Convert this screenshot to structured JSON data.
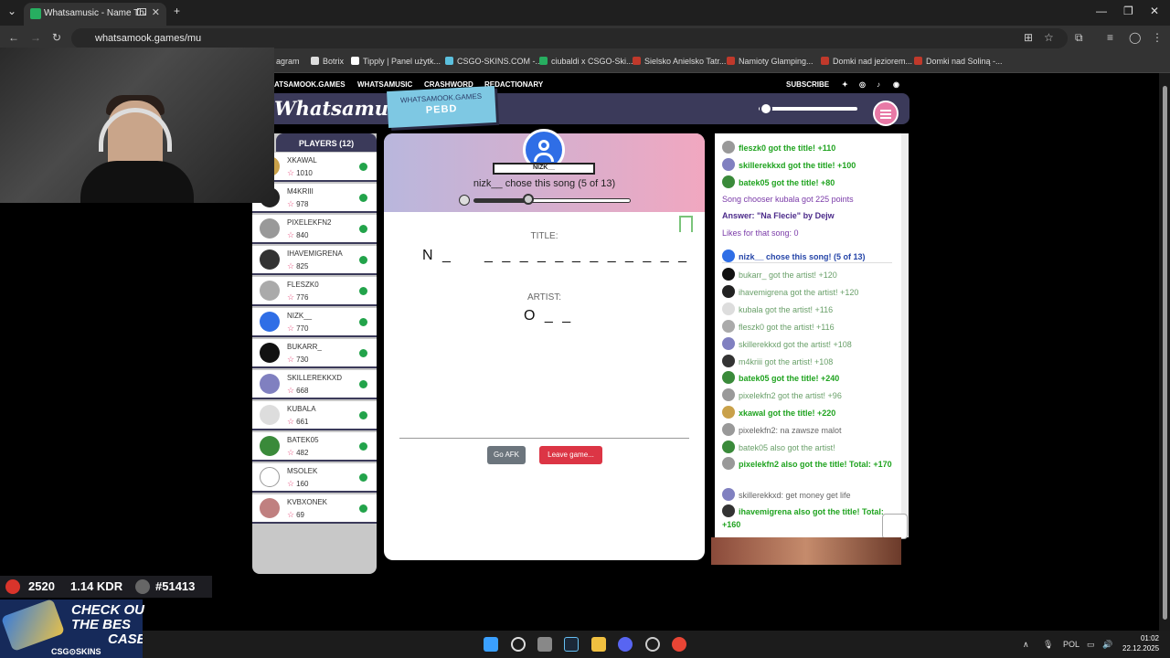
{
  "browser": {
    "tab_title": "Whatsamusic - Name That",
    "url": "whatsamook.games/mu",
    "bookmarks": [
      "agram",
      "Botrix",
      "Tipply | Panel użytk...",
      "CSGO-SKINS.COM -...",
      "ciubaldi x CSGO-Ski...",
      "Sielsko Anielsko Tatr...",
      "Namioty Glamping...",
      "Domki nad jeziorem...",
      "Domki nad Soliną -..."
    ]
  },
  "site_nav": {
    "items": [
      "ATSAMOOK.GAMES",
      "WHATSAMUSIC",
      "CRASHWORD",
      "REDACTIONARY"
    ],
    "subscribe": "SUBSCRIBE"
  },
  "header": {
    "logo": "Whatsamusic",
    "badge_line1": "WHATSAMOOK.GAMES",
    "badge_line2": "PEBD"
  },
  "players": {
    "heading": "PLAYERS (12)",
    "list": [
      {
        "name": "XKAWAL",
        "score": "1010"
      },
      {
        "name": "M4KRIII",
        "score": "978"
      },
      {
        "name": "PIXELEKFN2",
        "score": "840"
      },
      {
        "name": "IHAVEMIGRENA",
        "score": "825"
      },
      {
        "name": "FLESZK0",
        "score": "776"
      },
      {
        "name": "NIZK__",
        "score": "770"
      },
      {
        "name": "BUKARR_",
        "score": "730"
      },
      {
        "name": "SKILLEREKKXD",
        "score": "668"
      },
      {
        "name": "KUBALA",
        "score": "661"
      },
      {
        "name": "BATEK05",
        "score": "482"
      },
      {
        "name": "MSOLEK",
        "score": "160"
      },
      {
        "name": "KVBXONEK",
        "score": "69"
      }
    ]
  },
  "round": {
    "chooser_ribbon": "NIZK__",
    "chooser_text": "nizk__ chose this song (5 of 13)",
    "progress": 0.35,
    "title_label": "TITLE:",
    "title_hint_1": "N _",
    "title_hint_2": "_ _ _ _ _",
    "title_hint_3": "_ _ _ _ _ _ _",
    "artist_label": "ARTIST:",
    "artist_hint": "O _ _",
    "afk_button": "Go AFK",
    "leave_button": "Leave game..."
  },
  "chat": {
    "lines": [
      {
        "text": "fleszk0 got the title! +110",
        "style": "green",
        "avatar": true
      },
      {
        "text": "skillerekkxd got the title! +100",
        "style": "green",
        "avatar": true
      },
      {
        "text": "batek05 got the title! +80",
        "style": "green",
        "avatar": true
      },
      {
        "text": "Song chooser kubala got 225 points",
        "style": "purple",
        "avatar": false
      },
      {
        "text": "Answer: \"Na Flecie\" by Dejw",
        "style": "dpurple",
        "avatar": false
      },
      {
        "text": "Likes for that song: 0",
        "style": "purple",
        "avatar": false
      },
      {
        "text": "nizk__ chose this song! (5 of 13)",
        "style": "navy",
        "avatar": true
      },
      {
        "text": "bukarr_ got the artist! +120",
        "style": "mgreen",
        "avatar": true
      },
      {
        "text": "ihavemigrena got the artist! +120",
        "style": "mgreen",
        "avatar": true
      },
      {
        "text": "kubala got the artist! +116",
        "style": "mgreen",
        "avatar": true
      },
      {
        "text": "fleszk0 got the artist! +116",
        "style": "mgreen",
        "avatar": true
      },
      {
        "text": "skillerekkxd got the artist! +108",
        "style": "mgreen",
        "avatar": true
      },
      {
        "text": "m4kriii got the artist! +108",
        "style": "mgreen",
        "avatar": true
      },
      {
        "text": "batek05 got the title! +240",
        "style": "green",
        "avatar": true
      },
      {
        "text": "pixelekfn2 got the artist! +96",
        "style": "mgreen",
        "avatar": true
      },
      {
        "text": "xkawal got the title! +220",
        "style": "green",
        "avatar": true
      },
      {
        "text": "pixelekfn2: na zawsze malot",
        "style": "grey",
        "avatar": true
      },
      {
        "text": "batek05 also got the artist!",
        "style": "mgreen",
        "avatar": true
      },
      {
        "text": "pixelekfn2 also got the title! Total: +170",
        "style": "green",
        "avatar": true
      },
      {
        "text": "skillerekkxd: get money get life",
        "style": "grey",
        "avatar": true
      },
      {
        "text": "ihavemigrena also got the title! Total: +160",
        "style": "green",
        "avatar": true
      }
    ]
  },
  "stream_overlay": {
    "elo": "2520",
    "kdr": "1.14 KDR",
    "rank": "#51413",
    "promo_line1": "CHECK OU",
    "promo_line2": "THE BES",
    "promo_line3": "CASE",
    "promo_brand": "CSG⊙SKINS"
  },
  "taskbar": {
    "lang": "POL",
    "time": "01:02",
    "date": "22.12.2025"
  },
  "colors": {
    "accent": "#3b3a5a",
    "green": "#1fa31f",
    "danger": "#dc3545"
  }
}
